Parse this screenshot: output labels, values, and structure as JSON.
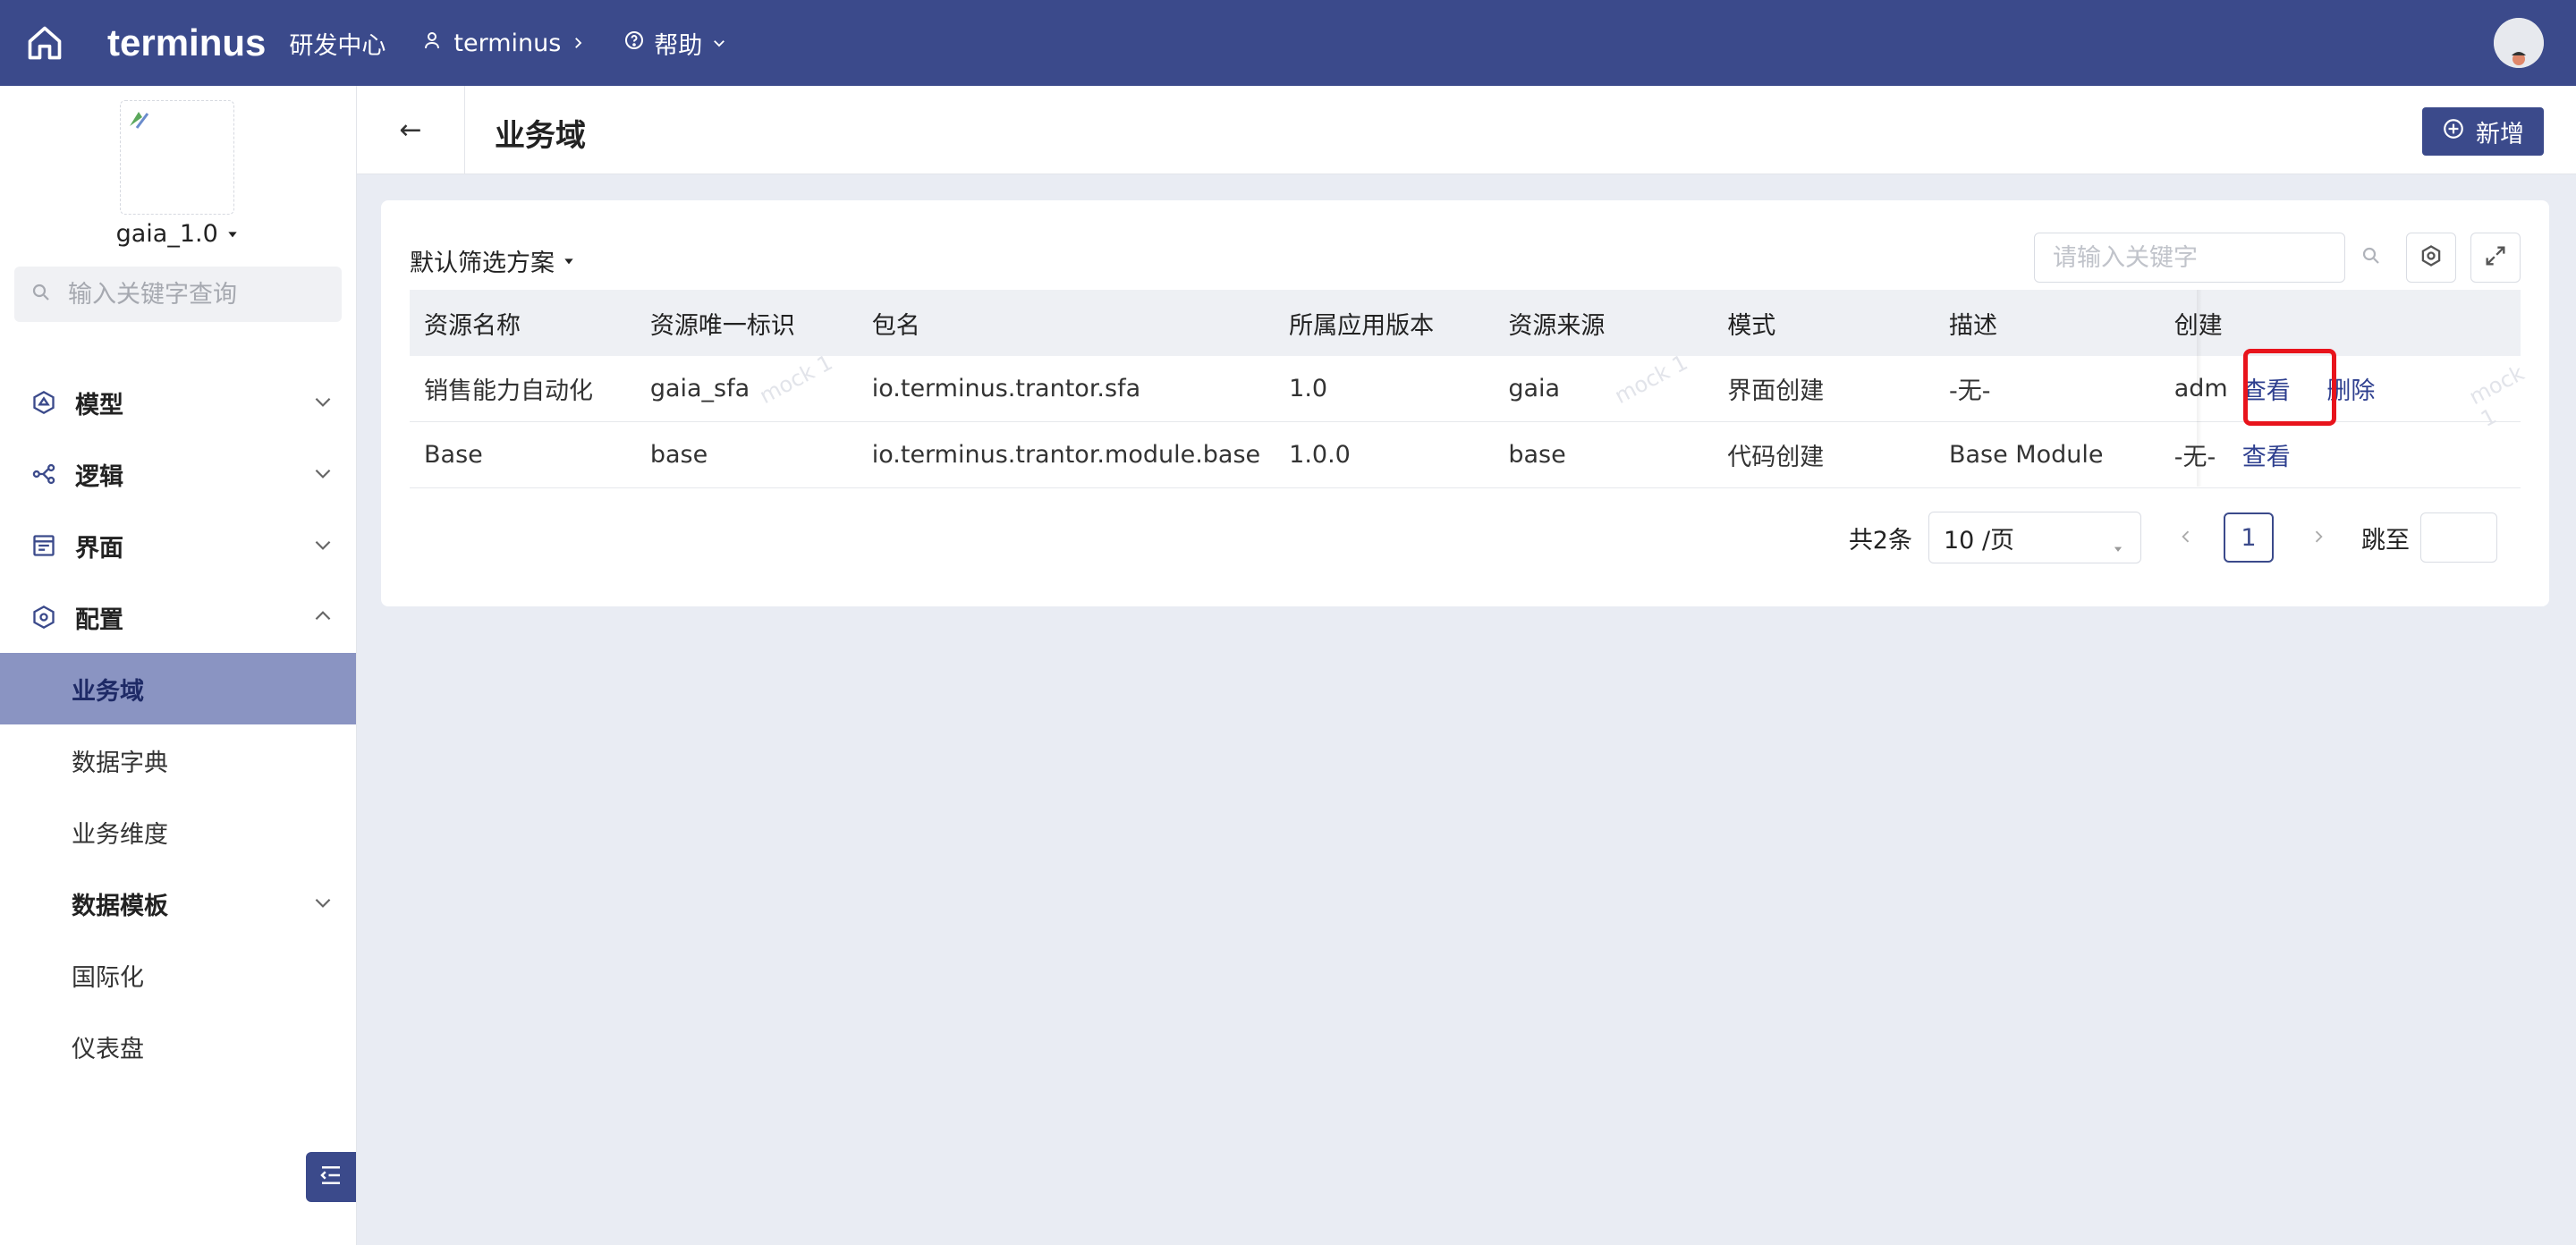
{
  "topbar": {
    "logo": "terminus",
    "dev_center": "研发中心",
    "org": "terminus",
    "help": "帮助"
  },
  "sidebar": {
    "app_name": "gaia_1.0",
    "search_placeholder": "输入关键字查询",
    "menu": {
      "model": "模型",
      "logic": "逻辑",
      "ui": "界面",
      "config": "配置"
    },
    "config_items": {
      "business_domain": "业务域",
      "data_dictionary": "数据字典",
      "business_dimension": "业务维度",
      "data_template": "数据模板",
      "i18n": "国际化",
      "dashboard": "仪表盘"
    }
  },
  "header": {
    "back": "←",
    "title": "业务域",
    "add_label": "新增"
  },
  "card": {
    "filter_plan": "默认筛选方案",
    "search_placeholder": "请输入关键字",
    "columns": [
      "资源名称",
      "资源唯一标识",
      "包名",
      "所属应用版本",
      "资源来源",
      "模式",
      "描述",
      "创建"
    ],
    "rows": [
      {
        "name": "销售能力自动化",
        "key": "gaia_sfa",
        "package": "io.terminus.trantor.sfa",
        "version": "1.0",
        "source": "gaia",
        "mode": "界面创建",
        "desc": "-无-",
        "creator": "adm",
        "op_view": "查看",
        "op_delete": "删除"
      },
      {
        "name": "Base",
        "key": "base",
        "package": "io.terminus.trantor.module.base",
        "version": "1.0.0",
        "source": "base",
        "mode": "代码创建",
        "desc": "Base Module",
        "creator": "-无-",
        "op_view": "查看"
      }
    ],
    "watermark": "mock 1",
    "pager": {
      "total": "共2条",
      "page_size": "10 /页",
      "current_page": "1",
      "jump_label": "跳至"
    }
  }
}
